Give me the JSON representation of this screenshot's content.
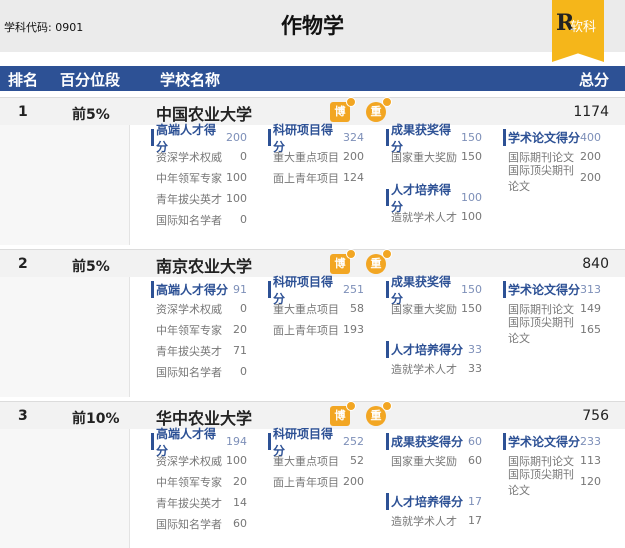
{
  "header": {
    "code_label": "学科代码: 0901",
    "title": "作物学",
    "logo_letter": "R",
    "logo_text": "软科"
  },
  "columns": {
    "rank": "排名",
    "percentile": "百分位段",
    "school": "学校名称",
    "total": "总分"
  },
  "badges": {
    "bo": "博",
    "zhong": "重"
  },
  "accent_color": "#2d5195",
  "badge_color": "#f2a623",
  "rows": [
    {
      "rank": "1",
      "percentile": "前5%",
      "school": "中国农业大学",
      "total": "1174",
      "g1": {
        "label": "高端人才得分",
        "value": "200",
        "items": [
          {
            "label": "资深学术权威",
            "value": "0"
          },
          {
            "label": "中年领军专家",
            "value": "100"
          },
          {
            "label": "青年拔尖英才",
            "value": "100"
          },
          {
            "label": "国际知名学者",
            "value": "0"
          }
        ]
      },
      "g2": {
        "label": "科研项目得分",
        "value": "324",
        "items": [
          {
            "label": "重大重点项目",
            "value": "200"
          },
          {
            "label": "面上青年项目",
            "value": "124"
          }
        ]
      },
      "g3": {
        "label": "成果获奖得分",
        "value": "150",
        "items": [
          {
            "label": "国家重大奖励",
            "value": "150"
          }
        ]
      },
      "g4": {
        "label": "人才培养得分",
        "value": "100",
        "items": [
          {
            "label": "造就学术人才",
            "value": "100"
          }
        ]
      },
      "g5": {
        "label": "学术论文得分",
        "value": "400",
        "items": [
          {
            "label": "国际期刊论文",
            "value": "200"
          },
          {
            "label": "国际顶尖期刊论文",
            "value": "200"
          }
        ]
      }
    },
    {
      "rank": "2",
      "percentile": "前5%",
      "school": "南京农业大学",
      "total": "840",
      "g1": {
        "label": "高端人才得分",
        "value": "91",
        "items": [
          {
            "label": "资深学术权威",
            "value": "0"
          },
          {
            "label": "中年领军专家",
            "value": "20"
          },
          {
            "label": "青年拔尖英才",
            "value": "71"
          },
          {
            "label": "国际知名学者",
            "value": "0"
          }
        ]
      },
      "g2": {
        "label": "科研项目得分",
        "value": "251",
        "items": [
          {
            "label": "重大重点项目",
            "value": "58"
          },
          {
            "label": "面上青年项目",
            "value": "193"
          }
        ]
      },
      "g3": {
        "label": "成果获奖得分",
        "value": "150",
        "items": [
          {
            "label": "国家重大奖励",
            "value": "150"
          }
        ]
      },
      "g4": {
        "label": "人才培养得分",
        "value": "33",
        "items": [
          {
            "label": "造就学术人才",
            "value": "33"
          }
        ]
      },
      "g5": {
        "label": "学术论文得分",
        "value": "313",
        "items": [
          {
            "label": "国际期刊论文",
            "value": "149"
          },
          {
            "label": "国际顶尖期刊论文",
            "value": "165"
          }
        ]
      }
    },
    {
      "rank": "3",
      "percentile": "前10%",
      "school": "华中农业大学",
      "total": "756",
      "g1": {
        "label": "高端人才得分",
        "value": "194",
        "items": [
          {
            "label": "资深学术权威",
            "value": "100"
          },
          {
            "label": "中年领军专家",
            "value": "20"
          },
          {
            "label": "青年拔尖英才",
            "value": "14"
          },
          {
            "label": "国际知名学者",
            "value": "60"
          }
        ]
      },
      "g2": {
        "label": "科研项目得分",
        "value": "252",
        "items": [
          {
            "label": "重大重点项目",
            "value": "52"
          },
          {
            "label": "面上青年项目",
            "value": "200"
          }
        ]
      },
      "g3": {
        "label": "成果获奖得分",
        "value": "60",
        "items": [
          {
            "label": "国家重大奖励",
            "value": "60"
          }
        ]
      },
      "g4": {
        "label": "人才培养得分",
        "value": "17",
        "items": [
          {
            "label": "造就学术人才",
            "value": "17"
          }
        ]
      },
      "g5": {
        "label": "学术论文得分",
        "value": "233",
        "items": [
          {
            "label": "国际期刊论文",
            "value": "113"
          },
          {
            "label": "国际顶尖期刊论文",
            "value": "120"
          }
        ]
      }
    }
  ]
}
